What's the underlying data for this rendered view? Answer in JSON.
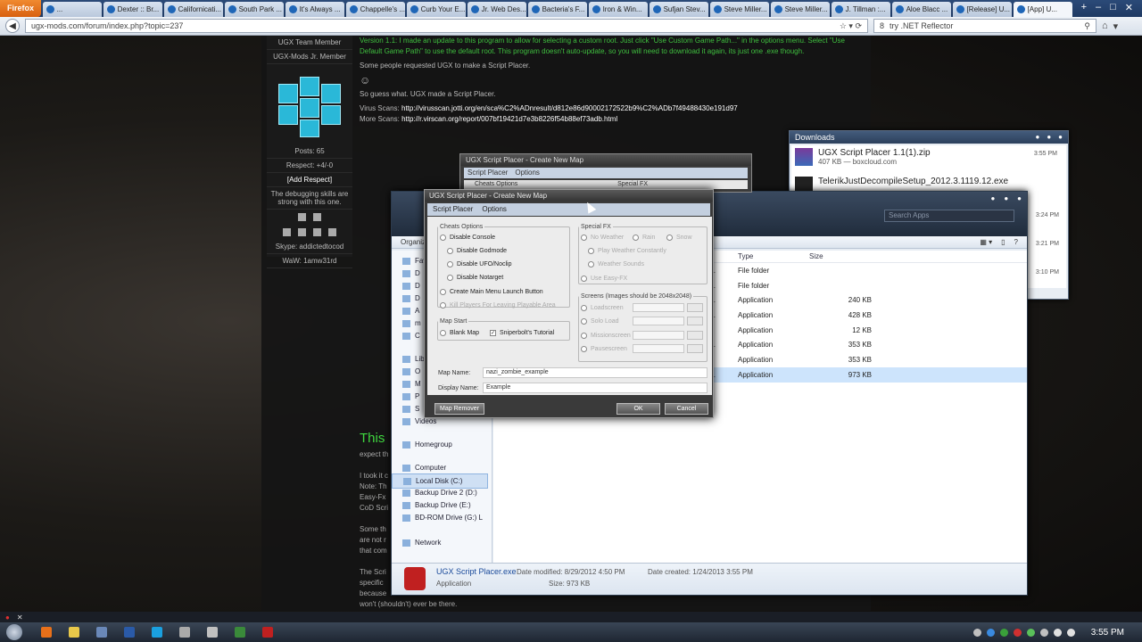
{
  "browser": {
    "app_button": "Firefox",
    "tabs": [
      {
        "label": "..."
      },
      {
        "label": "Dexter :: Br..."
      },
      {
        "label": "Californicati..."
      },
      {
        "label": "South Park ..."
      },
      {
        "label": "It's Always ..."
      },
      {
        "label": "Chappelle's ..."
      },
      {
        "label": "Curb Your E..."
      },
      {
        "label": "Jr. Web Des..."
      },
      {
        "label": "Bacteria's F..."
      },
      {
        "label": "Iron & Win..."
      },
      {
        "label": "Sufjan Stev..."
      },
      {
        "label": "Steve Miller..."
      },
      {
        "label": "Steve Miller..."
      },
      {
        "label": "J. Tillman :..."
      },
      {
        "label": "Aloe Blacc ..."
      },
      {
        "label": "[Release] U..."
      },
      {
        "label": "[App] U..."
      }
    ],
    "url": "ugx-mods.com/forum/index.php?topic=237",
    "search_value": "try .NET Reflector",
    "search_engine": "8"
  },
  "forum": {
    "profile": {
      "rank1": "UGX Team Member",
      "rank2": "UGX-Mods Jr. Member",
      "posts": "Posts: 65",
      "respect": "Respect: +4/-0",
      "add_respect": "[Add Respect]",
      "quote": "The debugging skills are strong with this one.",
      "skype": "Skype: addictedtocod",
      "wow": "WaW: 1amw31rd"
    },
    "post": {
      "version_note": "Version 1.1: I made an update to this program to allow for selecting a custom root. Just click \"Use Custom Game Path...\" in the options menu. Select \"Use Default Game Path\" to use the default root. This program doesn't auto-update, so you will need to download it again, its just one .exe though.",
      "request": "Some people requested UGX to make a Script Placer.",
      "guess": "So guess what. UGX made a Script Placer.",
      "virus_label": "Virus Scans:",
      "virus_link": "http://virusscan.jotti.org/en/sca%C2%ADnresult/d812e86d90002172522b9%C2%ADb7f49488430e191d97",
      "more_label": "More Scans:",
      "more_link": "http://r.virscan.org/report/007bf19421d7e3b8226f54b88ef73adb.html",
      "big_heading": "This",
      "frag1": "expect th",
      "frag2": "I took it c",
      "frag3": "Note: Th",
      "frag4": "Easy-Fx",
      "frag5": "CoD Scri",
      "frag6": "Some th",
      "frag7": "are not r",
      "frag8": "that com",
      "frag9": "The Scri",
      "frag10": "specific",
      "frag11": "because",
      "frag12": "won't (shouldn't) ever be there."
    }
  },
  "downloads": {
    "title": "Downloads",
    "items": [
      {
        "name": "UGX Script Placer 1.1(1).zip",
        "detail": "407 KB — boxcloud.com",
        "time": "3:55 PM"
      },
      {
        "name": "TelerikJustDecompileSetup_2012.3.1119.12.exe",
        "detail": "",
        "time": "3:55 PM"
      }
    ],
    "times_more": [
      "3:24 PM",
      "3:21 PM",
      "3:10 PM"
    ]
  },
  "explorer": {
    "search_placeholder": "Search Apps",
    "toolbar_left": "Organiz",
    "columns": {
      "type": "Type",
      "size": "Size"
    },
    "files": [
      {
        "frag": "P...",
        "type": "File folder",
        "size": ""
      },
      {
        "frag": "P...",
        "type": "File folder",
        "size": ""
      },
      {
        "frag": "P...",
        "type": "Application",
        "size": "240 KB"
      },
      {
        "frag": "P...",
        "type": "Application",
        "size": "428 KB"
      },
      {
        "frag": "2",
        "type": "Application",
        "size": "12 KB"
      },
      {
        "frag": "P...",
        "type": "Application",
        "size": "353 KB"
      },
      {
        "frag": "4",
        "type": "Application",
        "size": "353 KB"
      },
      {
        "frag": "P...",
        "type": "Application",
        "size": "973 KB"
      }
    ],
    "nav": [
      {
        "label": "Fav"
      },
      {
        "label": "D"
      },
      {
        "label": "D"
      },
      {
        "label": "D"
      },
      {
        "label": "A"
      },
      {
        "label": "m"
      },
      {
        "label": "C"
      },
      {
        "label": "Libr"
      },
      {
        "label": "O"
      },
      {
        "label": "M"
      },
      {
        "label": "P"
      },
      {
        "label": "S"
      },
      {
        "label": "Videos"
      },
      {
        "label": "Homegroup"
      },
      {
        "label": "Computer"
      },
      {
        "label": "Local Disk (C:)"
      },
      {
        "label": "Backup Drive 2 (D:)"
      },
      {
        "label": "Backup Drive (E:)"
      },
      {
        "label": "BD-ROM Drive (G:) L"
      },
      {
        "label": "Network"
      }
    ],
    "status": {
      "name": "UGX Script Placer.exe",
      "kind": "Application",
      "modified": "Date modified: 8/29/2012 4:50 PM",
      "size": "Size: 973 KB",
      "created": "Date created: 1/24/2013 3:55 PM"
    }
  },
  "dialog_back": {
    "title": "UGX Script Placer - Create New Map",
    "menu": [
      "Script Placer",
      "Options"
    ],
    "sub_left": "Cheats Options",
    "sub_right": "Special FX"
  },
  "dialog": {
    "title": "UGX Script Placer - Create New Map",
    "menu": [
      "Script Placer",
      "Options"
    ],
    "cheats": {
      "legend": "Cheats Options",
      "disable_console": "Disable Console",
      "disable_godmode": "Disable Godmode",
      "disable_ufo": "Disable UFO/Noclip",
      "disable_notarget": "Disable Notarget",
      "main_menu": "Create Main Menu Launch Button",
      "kill_players": "Kill Players For Leaving Playable Area"
    },
    "map_start": {
      "legend": "Map Start",
      "blank": "Blank Map",
      "tutorial": "Sniperbolt's Tutorial"
    },
    "fx": {
      "legend": "Special FX",
      "no_weather": "No Weather",
      "rain": "Rain",
      "snow": "Snow",
      "play_weather": "Play Weather Constantly",
      "weather_sounds": "Weather Sounds",
      "easy_fx": "Use Easy-FX"
    },
    "screens": {
      "legend": "Screens (Images should be 2048x2048)",
      "items": [
        "Loadscreen",
        "Solo Load",
        "Missionscreen",
        "Pausescreen"
      ]
    },
    "fields": {
      "map_name_label": "Map Name:",
      "map_name_value": "nazi_zombie_example",
      "display_name_label": "Display Name:",
      "display_name_value": "Example"
    },
    "buttons": {
      "remover": "Map Remover",
      "ok": "OK",
      "cancel": "Cancel"
    }
  },
  "taskbar": {
    "clock": "3:55 PM",
    "apps": [
      {
        "icon": "firefox-icon",
        "color": "#e8701a"
      },
      {
        "icon": "explorer-icon",
        "color": "#e8c84a"
      },
      {
        "icon": "doc-icon",
        "color": "#6a88b8"
      },
      {
        "icon": "ps-icon",
        "color": "#2a5aa8"
      },
      {
        "icon": "skype-icon",
        "color": "#1aa0e0"
      },
      {
        "icon": "radiant-icon",
        "color": "#aaaaaa"
      },
      {
        "icon": "tool-icon",
        "color": "#c0c0c0"
      },
      {
        "icon": "terminal-icon",
        "color": "#3a8a3a"
      },
      {
        "icon": "ugx-icon",
        "color": "#c02020"
      }
    ]
  }
}
